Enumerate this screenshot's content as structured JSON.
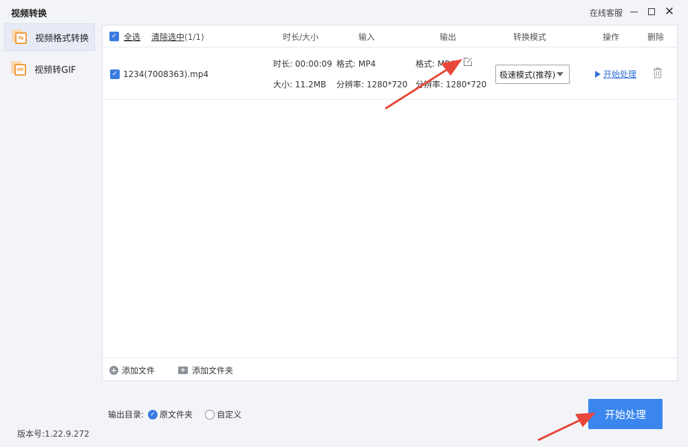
{
  "window": {
    "title": "视频转换",
    "support_label": "在线客服",
    "minimize_icon": "minimize-icon",
    "maximize_icon": "maximize-icon",
    "close_label": "✕"
  },
  "sidebar": {
    "items": [
      {
        "label": "视频格式转换",
        "icon": "video-convert-icon",
        "icon_glyph": "⇋",
        "active": true
      },
      {
        "label": "视频转GIF",
        "icon": "gif-icon",
        "icon_glyph": "GIF",
        "active": false
      }
    ],
    "version": "版本号:1.22.9.272"
  },
  "table": {
    "header": {
      "select_all": "全选",
      "clear_selected": "清除选中",
      "selected_count": "(1/1)",
      "duration_size": "时长/大小",
      "input": "输入",
      "output": "输出",
      "mode": "转换模式",
      "operation": "操作",
      "delete": "删除"
    },
    "rows": [
      {
        "checked": true,
        "filename": "1234(7008363).mp4",
        "duration": "时长: 00:00:09",
        "size": "大小: 11.2MB",
        "input_format": "格式: MP4",
        "input_resolution": "分辨率: 1280*720",
        "output_format": "格式: MP4",
        "output_resolution": "分辨率: 1280*720",
        "mode": "极速模式(推荐)",
        "action": "开始处理"
      }
    ],
    "footer": {
      "add_file": "添加文件",
      "add_folder": "添加文件夹"
    }
  },
  "output_dir": {
    "label": "输出目录:",
    "options": [
      "原文件夹",
      "自定义"
    ],
    "selected": "原文件夹"
  },
  "start_button": "开始处理",
  "colors": {
    "accent": "#3a86ee",
    "link": "#2f6fd8",
    "icon_orange": "#f09b3a",
    "annotation_arrow": "#e8463a"
  }
}
